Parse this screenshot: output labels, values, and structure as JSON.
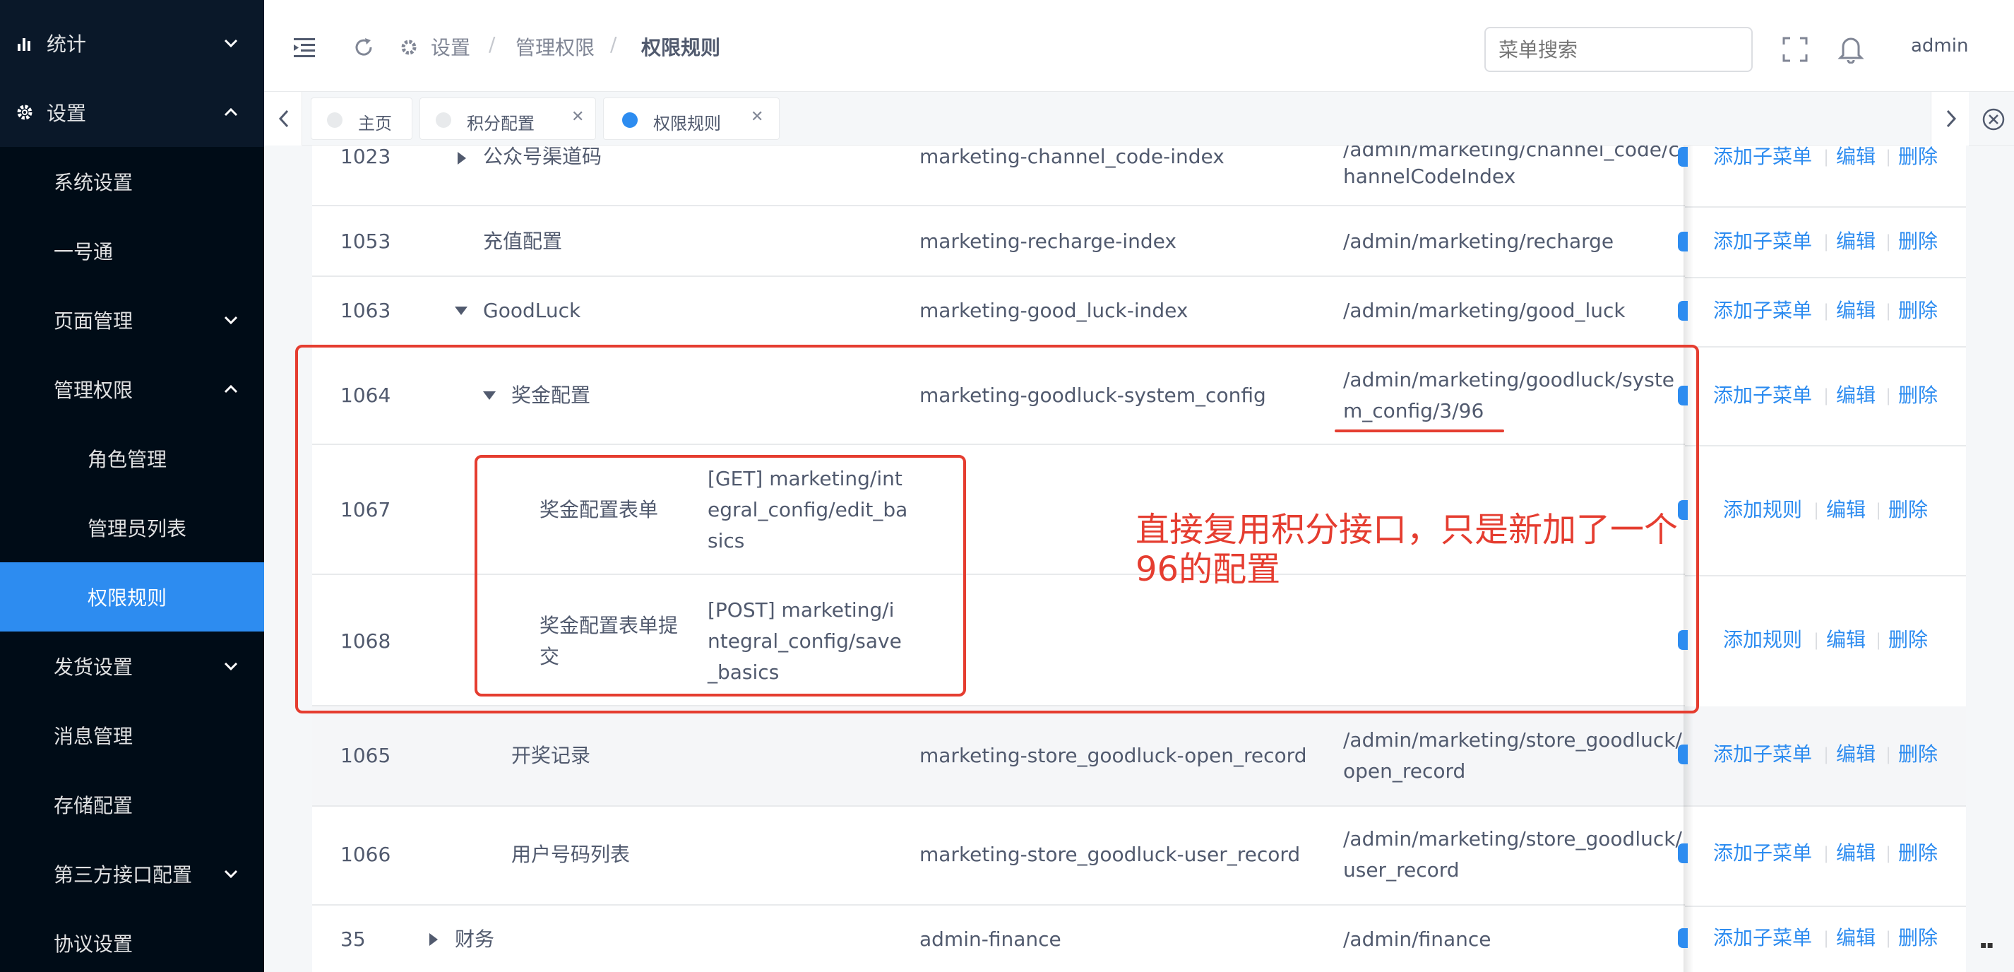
{
  "sidebar": {
    "items": [
      {
        "label": "统计",
        "icon": "bar-chart-icon",
        "expanded": false
      },
      {
        "label": "设置",
        "icon": "gear-icon",
        "expanded": true
      },
      {
        "label": "系统设置"
      },
      {
        "label": "一号通"
      },
      {
        "label": "页面管理",
        "expanded": false
      },
      {
        "label": "管理权限",
        "expanded": true
      },
      {
        "label": "角色管理"
      },
      {
        "label": "管理员列表"
      },
      {
        "label": "权限规则",
        "active": true
      },
      {
        "label": "发货设置",
        "expanded": false
      },
      {
        "label": "消息管理"
      },
      {
        "label": "存储配置"
      },
      {
        "label": "第三方接口配置",
        "expanded": false
      },
      {
        "label": "协议设置"
      }
    ]
  },
  "header": {
    "breadcrumb": [
      "设置",
      "管理权限",
      "权限规则"
    ],
    "search_placeholder": "菜单搜索",
    "user": "admin"
  },
  "tabs": [
    {
      "label": "主页",
      "active": false
    },
    {
      "label": "积分配置",
      "active": false
    },
    {
      "label": "权限规则",
      "active": true
    }
  ],
  "actions": {
    "add_submenu": "添加子菜单",
    "add_rule": "添加规则",
    "edit": "编辑",
    "delete": "删除"
  },
  "rows": [
    {
      "id": "1023",
      "name": "公众号渠道码",
      "code": "marketing-channel_code-index",
      "path1": "/admin/marketing/channel_code/c",
      "path2": "hannelCodeIndex",
      "arrow": "right",
      "type": "menu"
    },
    {
      "id": "1053",
      "name": "充值配置",
      "code": "marketing-recharge-index",
      "path1": "/admin/marketing/recharge",
      "path2": "",
      "arrow": "",
      "type": "menu"
    },
    {
      "id": "1063",
      "name": "GoodLuck",
      "code": "marketing-good_luck-index",
      "path1": "/admin/marketing/good_luck",
      "path2": "",
      "arrow": "down",
      "type": "menu"
    },
    {
      "id": "1064",
      "name": "奖金配置",
      "code": "marketing-goodluck-system_config",
      "path1": "/admin/marketing/goodluck/syste",
      "path2": "m_config/3/96",
      "arrow": "down",
      "type": "menu"
    },
    {
      "id": "1067",
      "name": "奖金配置表单",
      "name2": "",
      "api1": "[GET] marketing/int",
      "api2": "egral_config/edit_ba",
      "api3": "sics",
      "type": "rule"
    },
    {
      "id": "1068",
      "name": "奖金配置表单提",
      "name2": "交",
      "api1": "[POST] marketing/i",
      "api2": "ntegral_config/save",
      "api3": "_basics",
      "type": "rule"
    },
    {
      "id": "1065",
      "name": "开奖记录",
      "code": "marketing-store_goodluck-open_record",
      "path1": "/admin/marketing/store_goodluck/",
      "path2": "open_record",
      "arrow": "",
      "type": "menu"
    },
    {
      "id": "1066",
      "name": "用户号码列表",
      "code": "marketing-store_goodluck-user_record",
      "path1": "/admin/marketing/store_goodluck/",
      "path2": "user_record",
      "arrow": "",
      "type": "menu"
    },
    {
      "id": "35",
      "name": "财务",
      "code": "admin-finance",
      "path1": "/admin/finance",
      "path2": "",
      "arrow": "right",
      "type": "menu"
    }
  ],
  "annotation": {
    "line1": "直接复用积分接口，只是新加了一个",
    "line2": "96的配置"
  },
  "colors": {
    "sidebar_bg": "#0a1829",
    "active": "#2d8cf0",
    "annotation": "#e53d30"
  }
}
